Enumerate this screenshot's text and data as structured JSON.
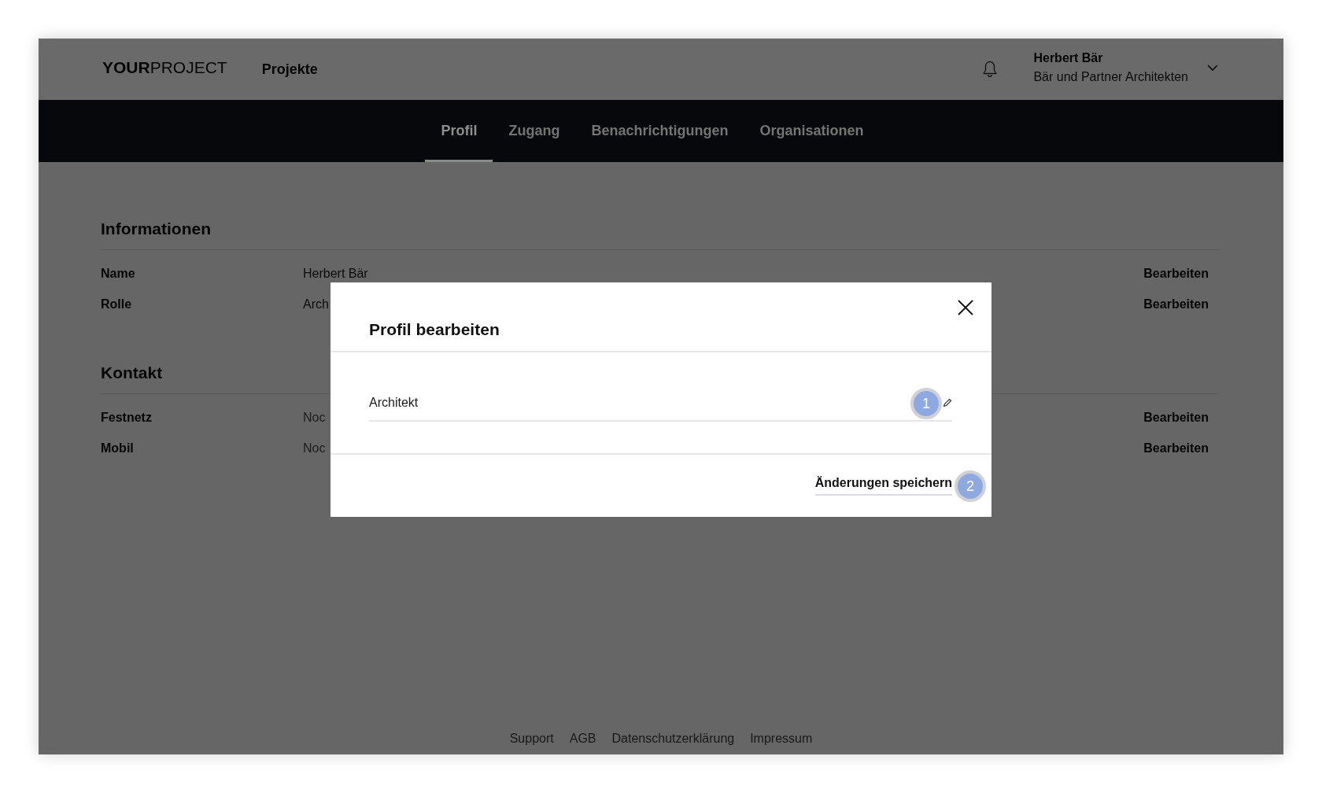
{
  "header": {
    "logo": "**YOUR**PROJECT",
    "nav_link": "Projekte",
    "user": {
      "name": "Herbert Bär",
      "organization": "Bär und Partner Architekten"
    }
  },
  "tabs": [
    {
      "label": "Profil",
      "selected": true
    },
    {
      "label": "Zugang",
      "selected": false
    },
    {
      "label": "Benachrichtigungen",
      "selected": false
    },
    {
      "label": "Organisationen",
      "selected": false
    }
  ],
  "sections": [
    {
      "title": "Informationen",
      "rows": [
        {
          "label": "Name",
          "value": "Herbert Bär",
          "empty": false,
          "action": "Bearbeiten"
        },
        {
          "label": "Rolle",
          "value": "Arch",
          "empty": false,
          "action": "Bearbeiten"
        }
      ]
    },
    {
      "title": "Kontakt",
      "rows": [
        {
          "label": "Festnetz",
          "value": "Noc",
          "empty": true,
          "action": "Bearbeiten"
        },
        {
          "label": "Mobil",
          "value": "Noc",
          "empty": true,
          "action": "Bearbeiten"
        }
      ]
    }
  ],
  "footer": {
    "links": [
      "Support",
      "AGB",
      "Datenschutzerklärung",
      "Impressum"
    ]
  },
  "dialog": {
    "title": "Profil bearbeiten",
    "field": {
      "value": "Architekt",
      "marker": "1"
    },
    "save_button": {
      "label": "Änderungen speichern",
      "marker": "2"
    }
  }
}
